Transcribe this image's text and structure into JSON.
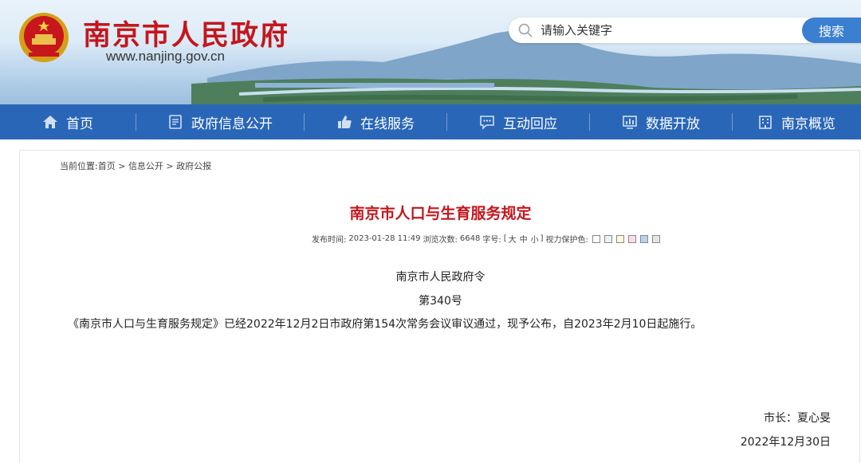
{
  "header": {
    "site_name": "南京市人民政府",
    "site_url": "www.nanjing.gov.cn",
    "emblem_icon": "national-emblem",
    "search": {
      "placeholder": "请输入关键字",
      "button_label": "搜索"
    }
  },
  "nav": {
    "items": [
      {
        "label": "首页",
        "icon": "home-icon"
      },
      {
        "label": "政府信息公开",
        "icon": "document-icon"
      },
      {
        "label": "在线服务",
        "icon": "thumbs-up-icon"
      },
      {
        "label": "互动回应",
        "icon": "chat-icon"
      },
      {
        "label": "数据开放",
        "icon": "data-chart-icon"
      },
      {
        "label": "南京概览",
        "icon": "building-icon"
      }
    ]
  },
  "breadcrumb": {
    "prefix": "当前位置:",
    "items": [
      "首页",
      "信息公开",
      "政府公报"
    ],
    "separator": " > "
  },
  "article": {
    "title": "南京市人口与生育服务规定",
    "meta": {
      "publish_label": "发布时间:",
      "publish_time": "2023-01-28 11:49",
      "views_label": "浏览次数:",
      "views": "6648",
      "font_label": "字号:",
      "font_open": "[",
      "font_sizes": [
        "大",
        "中",
        "小"
      ],
      "font_close": "]",
      "eye_label": "视力保护色:",
      "eye_colors": [
        "#ffffff",
        "#e6f3f9",
        "#fbfbd8",
        "#f7dcf0",
        "#b8d2f2",
        "#e6e6e6"
      ]
    },
    "issuer": "南京市人民政府令",
    "order_number": "第340号",
    "body": "《南京市人口与生育服务规定》已经2022年12月2日市政府第154次常务会议审议通过，现予公布，自2023年2月10日起施行。",
    "signer": "市长：夏心旻",
    "date": "2022年12月30日"
  },
  "colors": {
    "brand_red": "#c4161c",
    "nav_blue": "#2a66b8",
    "search_blue": "#3b7fd1"
  }
}
